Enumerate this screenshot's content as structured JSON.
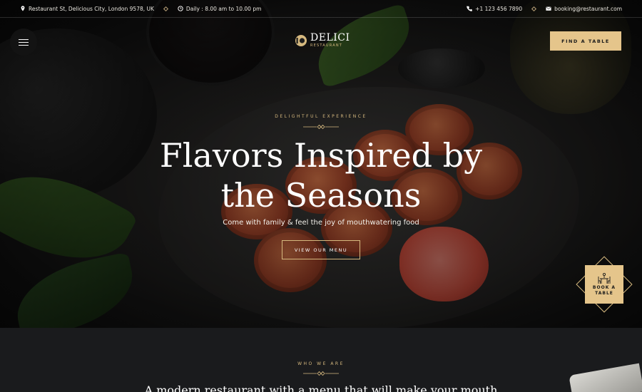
{
  "topbar": {
    "address": "Restaurant St, Delicious City, London 9578, UK",
    "hours": "Daily : 8.00 am to 10.00 pm",
    "phone": "+1 123 456 7890",
    "email": "booking@restaurant.com"
  },
  "header": {
    "logo_name": "DELICI",
    "logo_sub": "RESTAURANT",
    "find_table_label": "FIND A TABLE"
  },
  "hero": {
    "eyebrow": "DELIGHTFUL EXPERIENCE",
    "title_line1": "Flavors Inspired by",
    "title_line2": "the Seasons",
    "subtitle": "Come with family & feel the joy of mouthwatering food",
    "cta_label": "VIEW OUR MENU"
  },
  "book_badge": {
    "line1": "BOOK A",
    "line2": "TABLE"
  },
  "about": {
    "eyebrow": "WHO WE ARE",
    "title": "A modern restaurant with a menu that will make your mouth"
  },
  "colors": {
    "accent": "#e5c58b",
    "accent_line": "#d6b97f",
    "section_bg": "#1a1b1d"
  },
  "icons": [
    "location-icon",
    "clock-icon",
    "phone-icon",
    "mail-icon",
    "hamburger-icon",
    "logo-icon",
    "table-icon"
  ]
}
